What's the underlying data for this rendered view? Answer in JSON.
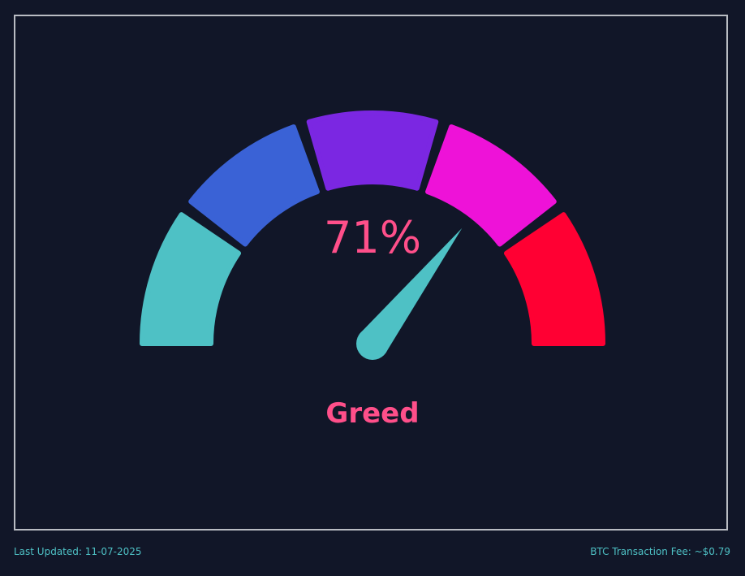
{
  "gauge": {
    "value": 71,
    "value_text": "71%",
    "label": "Greed",
    "min": 0,
    "max": 100,
    "colors": {
      "value_text": "#ff4f8a",
      "label": "#ff4f8a",
      "needle": "#4ec1c5",
      "segments": [
        "#4ec1c5",
        "#3a62d6",
        "#7b27e2",
        "#ee12d8",
        "#ff0033"
      ]
    }
  },
  "footer": {
    "last_updated": "Last Updated: 11-07-2025",
    "btc_fee": "BTC Transaction Fee: ~$0.79"
  },
  "colors": {
    "background": "#111628",
    "frame_border": "#b9bcc3",
    "footer_text": "#4ec1c5"
  }
}
